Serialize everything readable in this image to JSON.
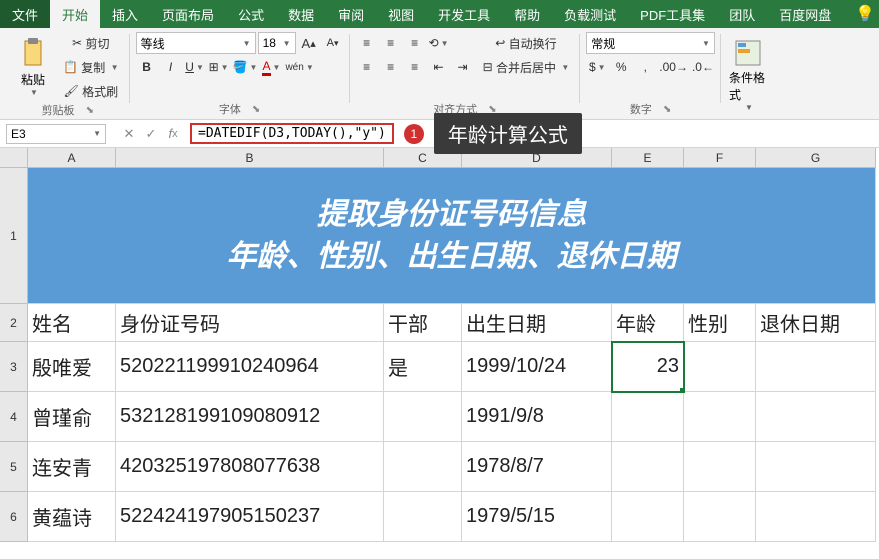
{
  "tabs": {
    "file": "文件",
    "items": [
      "开始",
      "插入",
      "页面布局",
      "公式",
      "数据",
      "审阅",
      "视图",
      "开发工具",
      "帮助",
      "负载测试",
      "PDF工具集",
      "团队",
      "百度网盘"
    ],
    "active": 0
  },
  "ribbon": {
    "clipboard": {
      "paste": "粘贴",
      "cut": "剪切",
      "copy": "复制",
      "format_painter": "格式刷",
      "label": "剪贴板"
    },
    "font": {
      "name": "等线",
      "size": "18",
      "label": "字体"
    },
    "align": {
      "wrap": "自动换行",
      "merge": "合并后居中",
      "label": "对齐方式"
    },
    "number": {
      "format": "常规",
      "label": "数字"
    },
    "styles": {
      "cond": "条件格式"
    }
  },
  "namebox": "E3",
  "formula": "=DATEDIF(D3,TODAY(),\"y\")",
  "annotation": {
    "num": "1",
    "text": "年龄计算公式"
  },
  "columns": [
    "A",
    "B",
    "C",
    "D",
    "E",
    "F",
    "G"
  ],
  "title": "提取身份证号码信息\n年龄、性别、出生日期、退休日期",
  "headers": {
    "name": "姓名",
    "id": "身份证号码",
    "cadre": "干部",
    "birth": "出生日期",
    "age": "年龄",
    "gender": "性别",
    "retire": "退休日期"
  },
  "rows": [
    {
      "name": "殷唯爱",
      "id": "520221199910240964",
      "cadre": "是",
      "birth": "1999/10/24",
      "age": "23"
    },
    {
      "name": "曾瑾俞",
      "id": "532128199109080912",
      "cadre": "",
      "birth": "1991/9/8",
      "age": ""
    },
    {
      "name": "连安青",
      "id": "420325197808077638",
      "cadre": "",
      "birth": "1978/8/7",
      "age": ""
    },
    {
      "name": "黄蕴诗",
      "id": "522424197905150237",
      "cadre": "",
      "birth": "1979/5/15",
      "age": ""
    }
  ],
  "row_numbers": [
    "1",
    "2",
    "3",
    "4",
    "5",
    "6"
  ],
  "chart_data": {
    "type": "table",
    "title": "提取身份证号码信息 年龄、性别、出生日期、退休日期",
    "columns": [
      "姓名",
      "身份证号码",
      "干部",
      "出生日期",
      "年龄",
      "性别",
      "退休日期"
    ],
    "rows": [
      [
        "殷唯爱",
        "520221199910240964",
        "是",
        "1999/10/24",
        23,
        null,
        null
      ],
      [
        "曾瑾俞",
        "532128199109080912",
        null,
        "1991/9/8",
        null,
        null,
        null
      ],
      [
        "连安青",
        "420325197808077638",
        null,
        "1978/8/7",
        null,
        null,
        null
      ],
      [
        "黄蕴诗",
        "522424197905150237",
        null,
        "1979/5/15",
        null,
        null,
        null
      ]
    ]
  }
}
